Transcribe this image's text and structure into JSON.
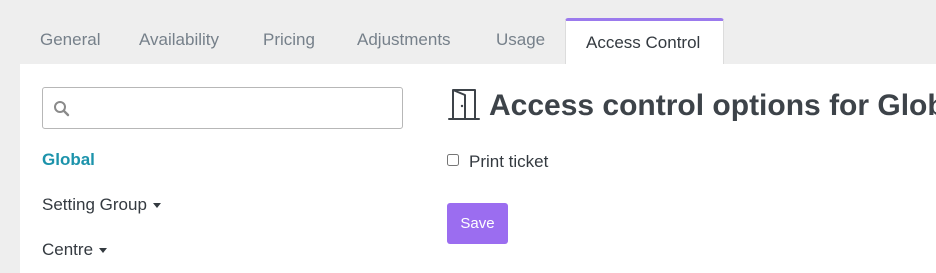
{
  "tabs": [
    {
      "label": "General",
      "active": false
    },
    {
      "label": "Availability",
      "active": false
    },
    {
      "label": "Pricing",
      "active": false
    },
    {
      "label": "Adjustments",
      "active": false
    },
    {
      "label": "Usage",
      "active": false
    },
    {
      "label": "Access Control",
      "active": true
    }
  ],
  "sidebar": {
    "search": {
      "value": "",
      "placeholder": "",
      "icon": "search-icon"
    },
    "items": [
      {
        "label": "Global",
        "active": true,
        "has_dropdown": false
      },
      {
        "label": "Setting Group",
        "active": false,
        "has_dropdown": true
      },
      {
        "label": "Centre",
        "active": false,
        "has_dropdown": true
      }
    ]
  },
  "main": {
    "title_icon": "door-icon",
    "title": "Access control options for Global",
    "options": [
      {
        "label": "Print ticket",
        "checked": false
      }
    ],
    "save_label": "Save"
  },
  "colors": {
    "accent": "#9b6df0",
    "active_link": "#1c93ab",
    "tab_active_border": "#9b7aed"
  }
}
